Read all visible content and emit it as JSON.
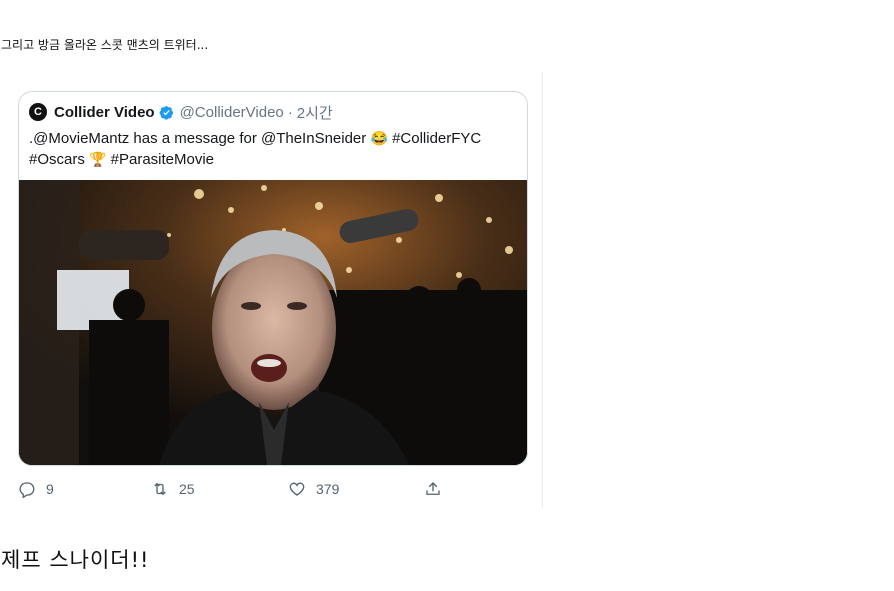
{
  "post": {
    "top_caption": "그리고 방금 올라온 스콧 맨츠의 트위터...",
    "bottom_caption": "제프 스나이더!!"
  },
  "tweet": {
    "logo_letter": "C",
    "display_name": "Collider Video",
    "handle": "@ColliderVideo",
    "separator": "·",
    "time": "2시간",
    "text_line1": ".@MovieMantz has a message for @TheInSneider",
    "text_line1_tail": "#ColliderFYC",
    "text_line2_a": "#Oscars",
    "text_line2_b": "#ParasiteMovie",
    "emoji_laugh": "😂",
    "emoji_oscar": "🏆",
    "media_icon": "video-thumbnail",
    "actions": {
      "reply_count": "9",
      "retweet_count": "25",
      "like_count": "379"
    }
  },
  "colors": {
    "verified": "#1d9bf0",
    "muted": "#657786",
    "border": "#cfd9de"
  }
}
